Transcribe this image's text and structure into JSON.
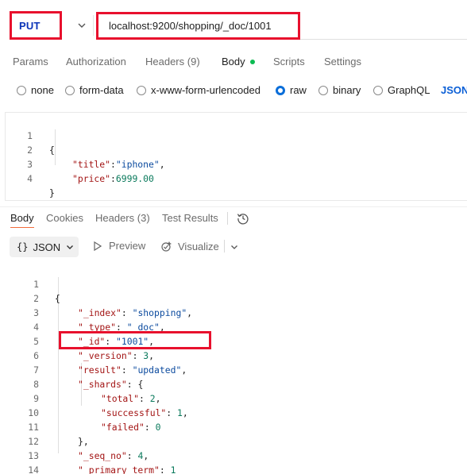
{
  "request": {
    "method": "PUT",
    "url": "localhost:9200/shopping/_doc/1001"
  },
  "request_tabs": {
    "params": "Params",
    "authorization": "Authorization",
    "headers": "Headers",
    "headers_count": "(9)",
    "body": "Body",
    "scripts": "Scripts",
    "settings": "Settings"
  },
  "body_types": {
    "none": "none",
    "form_data": "form-data",
    "urlencoded": "x-www-form-urlencoded",
    "raw": "raw",
    "binary": "binary",
    "graphql": "GraphQL",
    "format": "JSON",
    "selected": "raw"
  },
  "request_body": {
    "line_numbers": [
      "1",
      "2",
      "3",
      "4"
    ],
    "open_brace": "{",
    "title_key": "\"title\"",
    "title_value": "\"iphone\"",
    "price_key": "\"price\"",
    "price_value": "6999.00",
    "close_brace": "}"
  },
  "response_tabs": {
    "body": "Body",
    "cookies": "Cookies",
    "headers": "Headers",
    "headers_count": "(3)",
    "test_results": "Test Results"
  },
  "response_toolbar": {
    "format_icon": "{}",
    "format": "JSON",
    "preview": "Preview",
    "visualize": "Visualize"
  },
  "response_body": {
    "line_numbers": [
      "1",
      "2",
      "3",
      "4",
      "5",
      "6",
      "7",
      "8",
      "9",
      "10",
      "11",
      "12",
      "13",
      "14"
    ],
    "open_brace": "{",
    "index_key": "\"_index\"",
    "index_value": "\"shopping\"",
    "type_key": "\"_type\"",
    "type_value": "\"_doc\"",
    "id_key": "\"_id\"",
    "id_value": "\"1001\"",
    "version_key": "\"_version\"",
    "version_value": "3",
    "result_key": "\"result\"",
    "result_value": "\"updated\"",
    "shards_key": "\"_shards\"",
    "total_key": "\"total\"",
    "total_value": "2",
    "successful_key": "\"successful\"",
    "successful_value": "1",
    "failed_key": "\"failed\"",
    "failed_value": "0",
    "shards_close": "},",
    "seq_no_key": "\"_seq_no\"",
    "seq_no_value": "4",
    "primary_term_key": "\"_primary_term\"",
    "primary_term_value": "1",
    "close_brace": "}"
  },
  "colors": {
    "highlight_box": "#e8102d",
    "method": "#0b34b8",
    "json_key": "#a31515",
    "json_string": "#0b4a9e",
    "json_number": "#0a7a5c",
    "body_dot": "#0cbb52",
    "radio_selected": "#0b6ed9",
    "tab_underline": "#f26b3a"
  },
  "icons": {
    "method_caret": "chevron-down-icon",
    "preview": "play-icon",
    "visualize": "visualize-icon",
    "history": "history-icon"
  }
}
